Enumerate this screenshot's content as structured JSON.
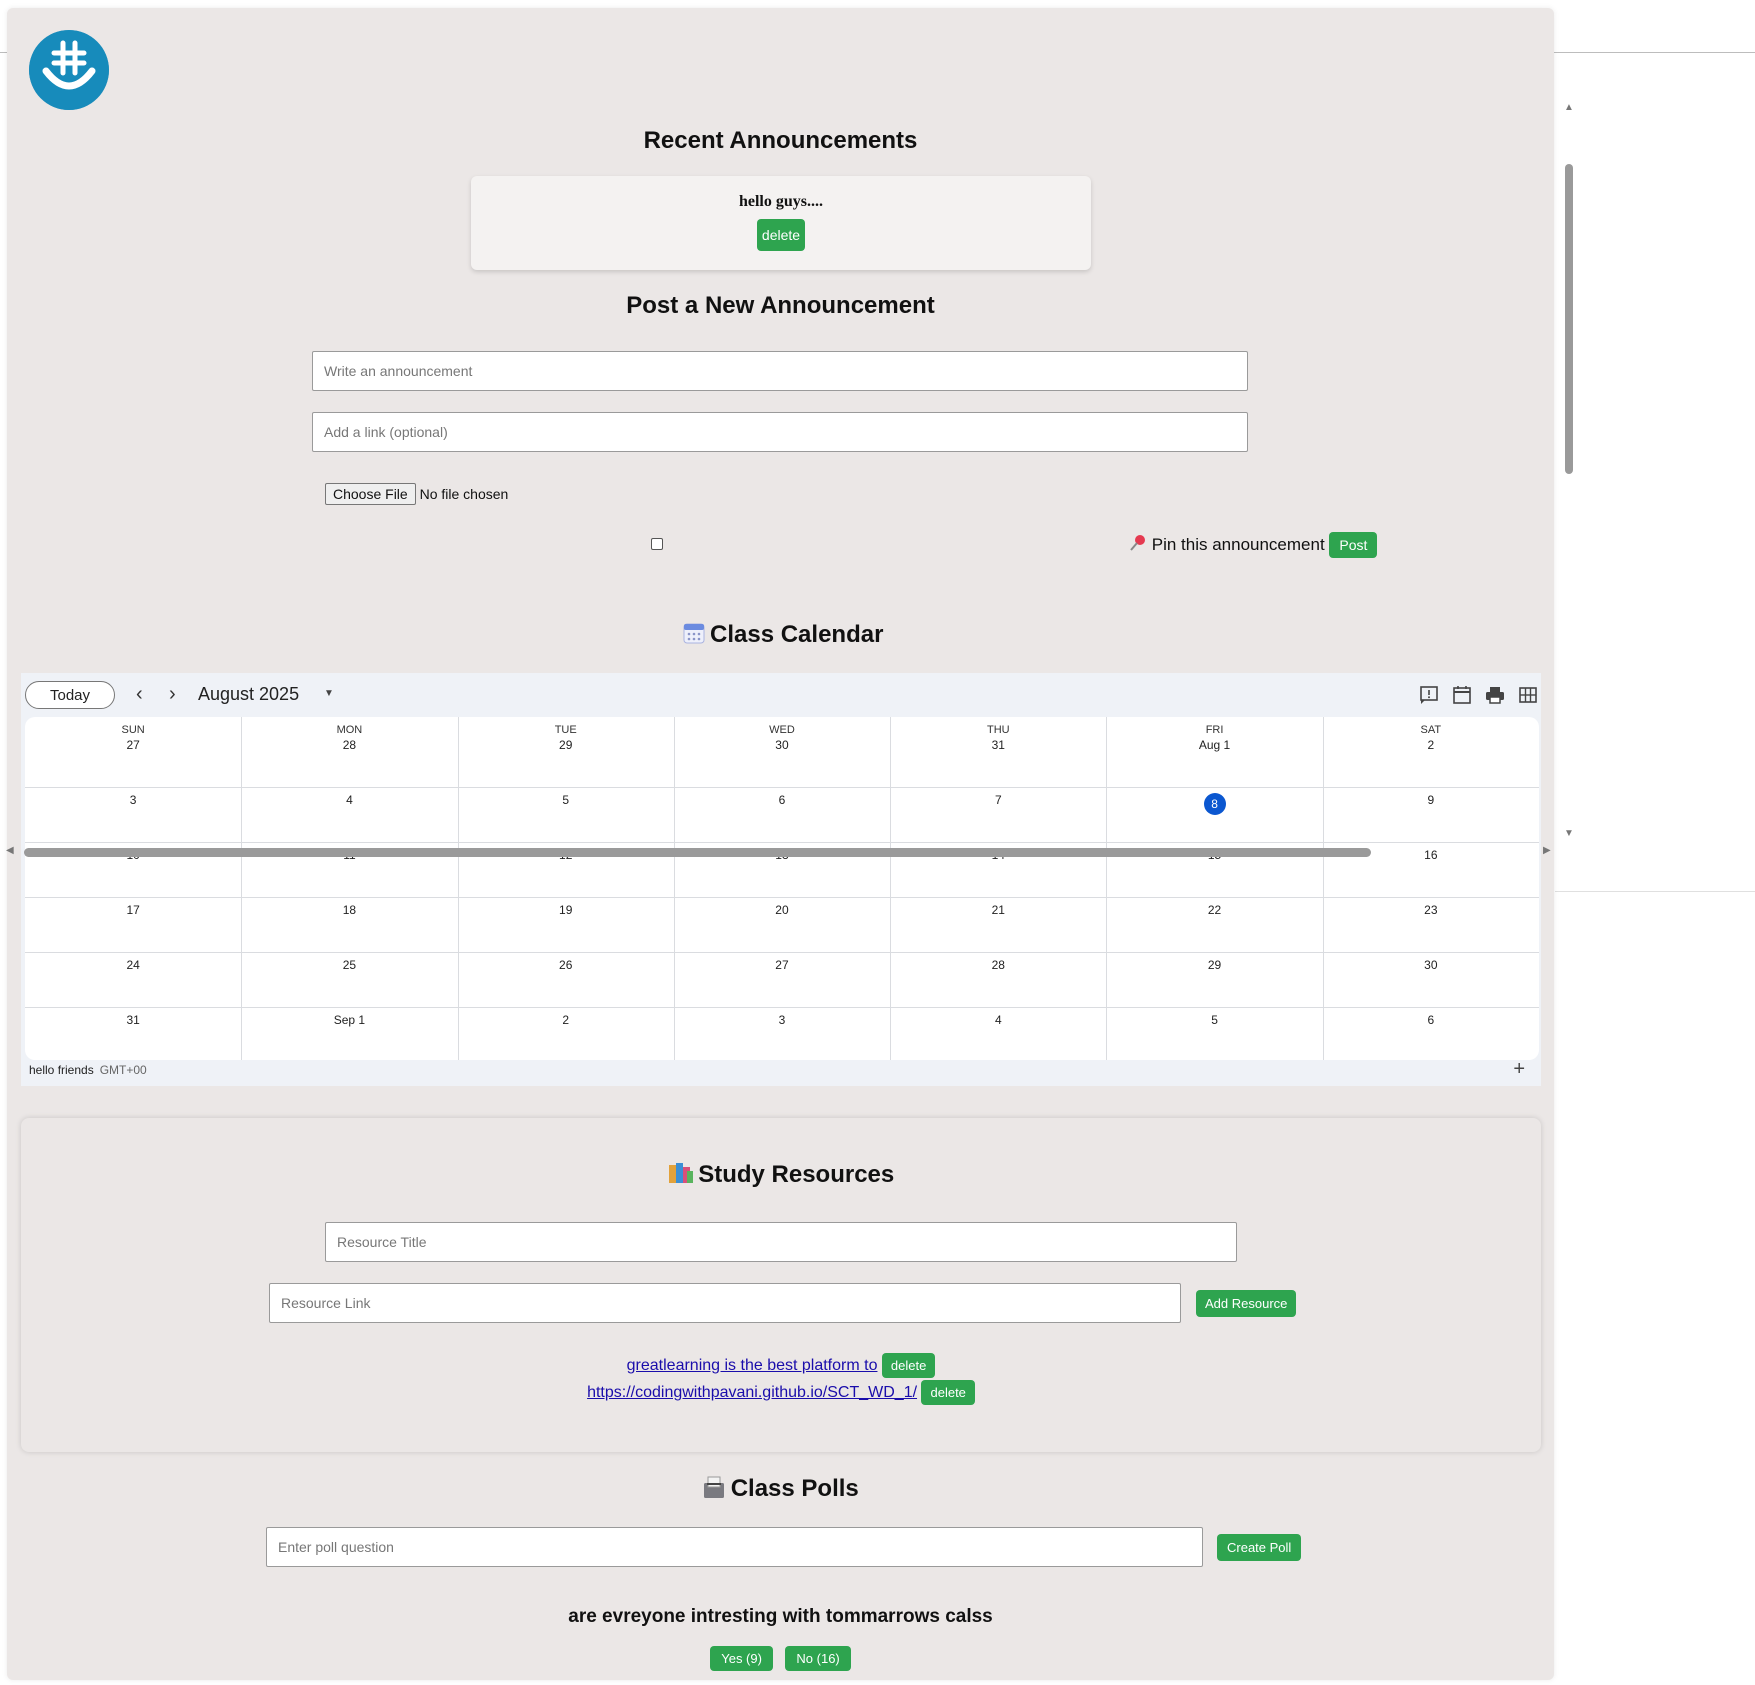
{
  "announcements": {
    "heading": "Recent Announcements",
    "items": [
      {
        "text": "hello guys....",
        "delete_label": "delete"
      }
    ]
  },
  "post": {
    "heading": "Post a New Announcement",
    "announcement_placeholder": "Write an announcement",
    "link_placeholder": "Add a link (optional)",
    "file_button": "Choose File",
    "file_status": "No file chosen",
    "pin_label": "Pin this announcement",
    "post_button": "Post"
  },
  "calendar": {
    "heading": "Class Calendar",
    "today_button": "Today",
    "month_label": "August 2025",
    "days_of_week": [
      "SUN",
      "MON",
      "TUE",
      "WED",
      "THU",
      "FRI",
      "SAT"
    ],
    "weeks": [
      [
        "27",
        "28",
        "29",
        "30",
        "31",
        "Aug 1",
        "2"
      ],
      [
        "3",
        "4",
        "5",
        "6",
        "7",
        "8",
        "9"
      ],
      [
        "10",
        "11",
        "12",
        "13",
        "14",
        "15",
        "16"
      ],
      [
        "17",
        "18",
        "19",
        "20",
        "21",
        "22",
        "23"
      ],
      [
        "24",
        "25",
        "26",
        "27",
        "28",
        "29",
        "30"
      ],
      [
        "31",
        "Sep 1",
        "2",
        "3",
        "4",
        "5",
        "6"
      ]
    ],
    "today_date": "8",
    "footer_name": "hello friends",
    "footer_tz": "GMT+00",
    "add_symbol": "+"
  },
  "resources": {
    "heading": "Study Resources",
    "title_placeholder": "Resource Title",
    "link_placeholder": "Resource Link",
    "add_button": "Add Resource",
    "items": [
      {
        "text": "greatlearning is the best platform to",
        "delete_label": "delete"
      },
      {
        "text": "https://codingwithpavani.github.io/SCT_WD_1/",
        "delete_label": "delete"
      }
    ]
  },
  "polls": {
    "heading": "Class Polls",
    "question_placeholder": "Enter poll question",
    "create_button": "Create Poll",
    "items": [
      {
        "question": "are evreyone intresting with tommarrows calss",
        "yes_label": "Yes (9)",
        "no_label": "No (16)"
      }
    ]
  },
  "colors": {
    "accent_green": "#2ea44f",
    "today_blue": "#0b57d0",
    "logo_blue": "#1a8fbf",
    "page_bg": "#ebe7e6"
  },
  "icons": [
    "groupme-logo-icon",
    "calendar-icon",
    "books-icon",
    "ballot-box-icon",
    "pushpin-icon",
    "chevron-left-icon",
    "chevron-right-icon",
    "dropdown-arrow-icon",
    "feedback-icon",
    "calendar-view-icon",
    "print-icon",
    "grid-view-icon",
    "plus-icon"
  ]
}
